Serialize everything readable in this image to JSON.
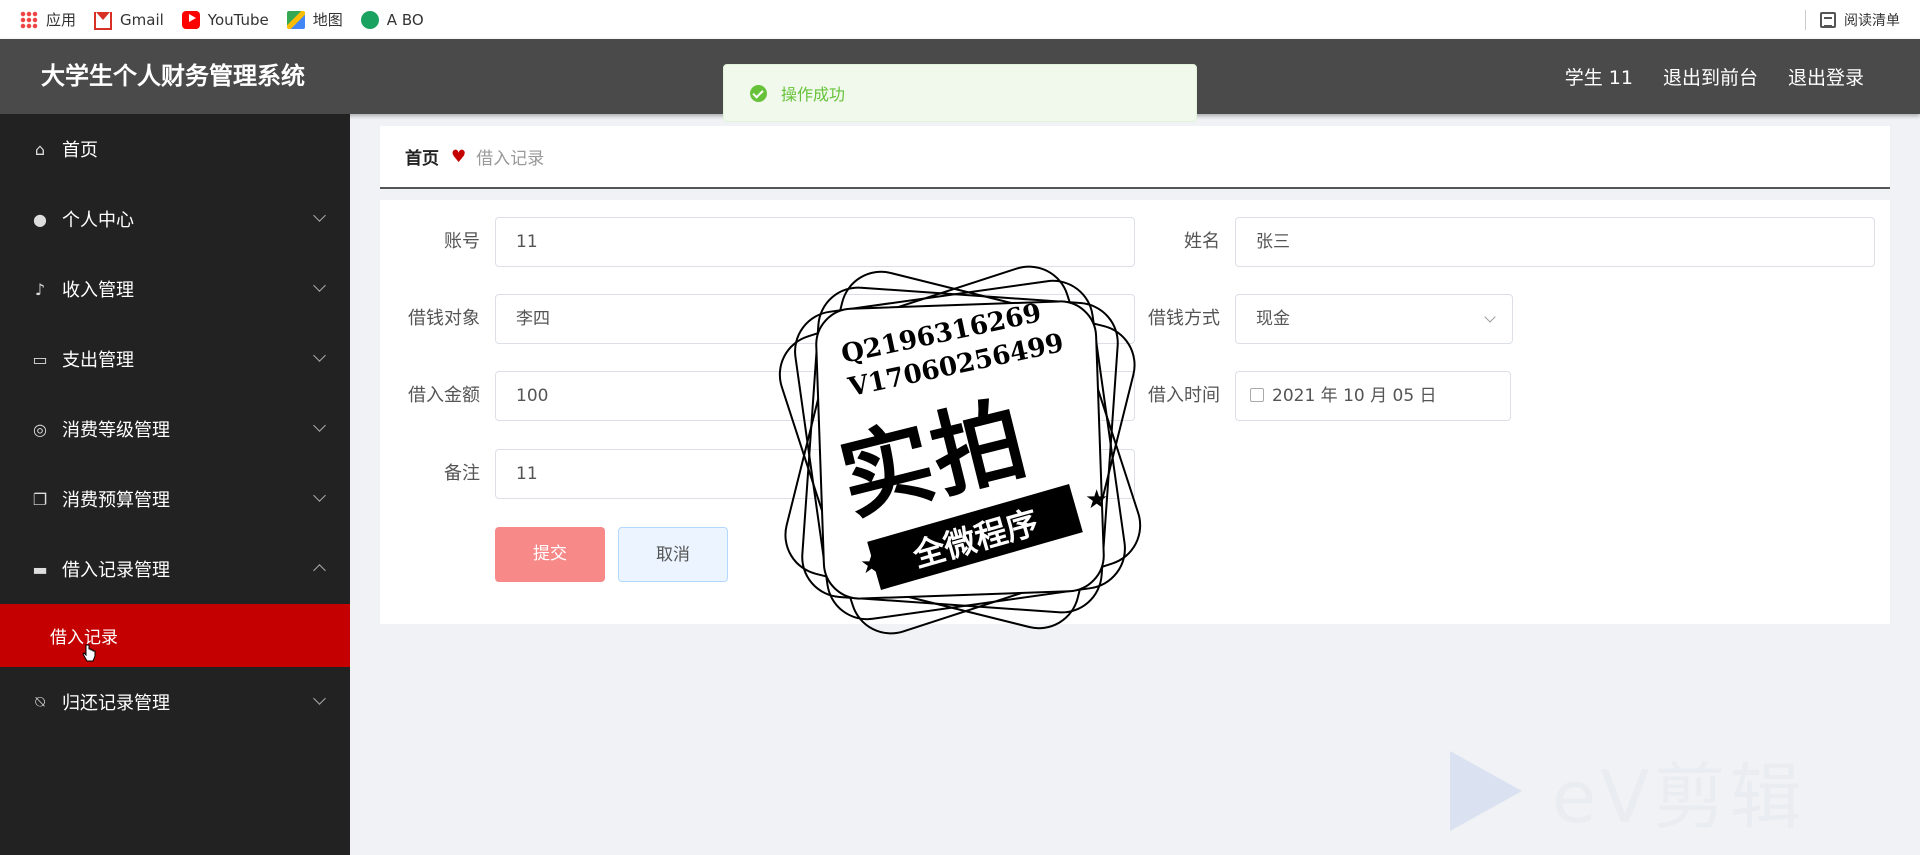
{
  "bookmarks": {
    "items": [
      {
        "label": "应用",
        "icon": "apps-grid-icon"
      },
      {
        "label": "Gmail",
        "icon": "gmail-icon"
      },
      {
        "label": "YouTube",
        "icon": "youtube-icon"
      },
      {
        "label": "地图",
        "icon": "maps-icon"
      },
      {
        "label": "A BO",
        "icon": "abo-icon"
      }
    ],
    "reading_list": "阅读清单"
  },
  "header": {
    "title": "大学生个人财务管理系统",
    "user": "学生 11",
    "to_frontend": "退出到前台",
    "logout": "退出登录",
    "bg_color": "#4a4a4a"
  },
  "toast": {
    "message": "操作成功",
    "color": "#67c23a"
  },
  "sidebar": {
    "items": [
      {
        "label": "首页",
        "icon": "home-icon"
      },
      {
        "label": "个人中心",
        "icon": "user-icon"
      },
      {
        "label": "收入管理",
        "icon": "microphone-icon"
      },
      {
        "label": "支出管理",
        "icon": "chat-icon"
      },
      {
        "label": "消费等级管理",
        "icon": "target-icon"
      },
      {
        "label": "消费预算管理",
        "icon": "copy-icon"
      },
      {
        "label": "借入记录管理",
        "icon": "ticket-icon"
      },
      {
        "label": "归还记录管理",
        "icon": "bell-off-icon"
      }
    ],
    "active_sub": "借入记录",
    "active_color": "#c40000"
  },
  "breadcrumb": {
    "home": "首页",
    "current": "借入记录"
  },
  "form": {
    "account": {
      "label": "账号",
      "value": "11"
    },
    "name": {
      "label": "姓名",
      "value": "张三"
    },
    "lender": {
      "label": "借钱对象",
      "value": "李四"
    },
    "method": {
      "label": "借钱方式",
      "value": "现金"
    },
    "amount": {
      "label": "借入金额",
      "value": "100"
    },
    "date": {
      "label": "借入时间",
      "value": "2021 年 10 月 05 日"
    },
    "note": {
      "label": "备注",
      "value": "11"
    },
    "submit": "提交",
    "cancel": "取消"
  },
  "stamp": {
    "line1": "Q2196316269",
    "line2": "V17060256499",
    "big": "实拍",
    "ribbon": "全微程序"
  },
  "watermark": {
    "text": "eV剪辑"
  }
}
